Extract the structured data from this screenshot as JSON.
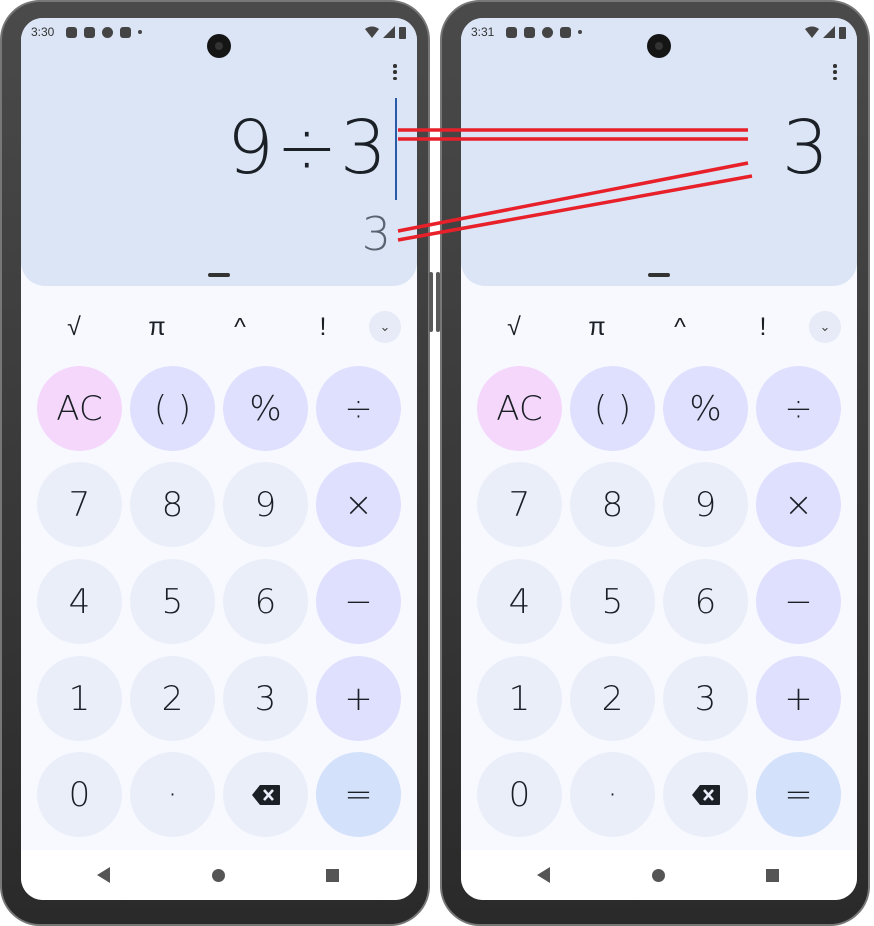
{
  "left_phone": {
    "status_time": "3:30",
    "expression": "9÷3",
    "preview_result": "3"
  },
  "right_phone": {
    "status_time": "3:31",
    "result": "3"
  },
  "scientific_row": [
    "√",
    "π",
    "^",
    "!"
  ],
  "keypad": [
    [
      "AC",
      "( )",
      "%",
      "÷"
    ],
    [
      "7",
      "8",
      "9",
      "×"
    ],
    [
      "4",
      "5",
      "6",
      "−"
    ],
    [
      "1",
      "2",
      "3",
      "+"
    ],
    [
      "0",
      "·",
      "⌫",
      "="
    ]
  ],
  "icons": {
    "menu": "more-vert-icon",
    "expand": "chevron-down-icon",
    "backspace": "backspace-icon",
    "nav": [
      "back-icon",
      "home-icon",
      "recent-apps-icon"
    ]
  },
  "colors": {
    "display_bg": "#dbe5f6",
    "number_key": "#e9eef9",
    "operator_key": "#dfe0fd",
    "clear_key": "#f4d7fb",
    "equals_key": "#d3e1fb",
    "annotation": "#e8202a"
  }
}
